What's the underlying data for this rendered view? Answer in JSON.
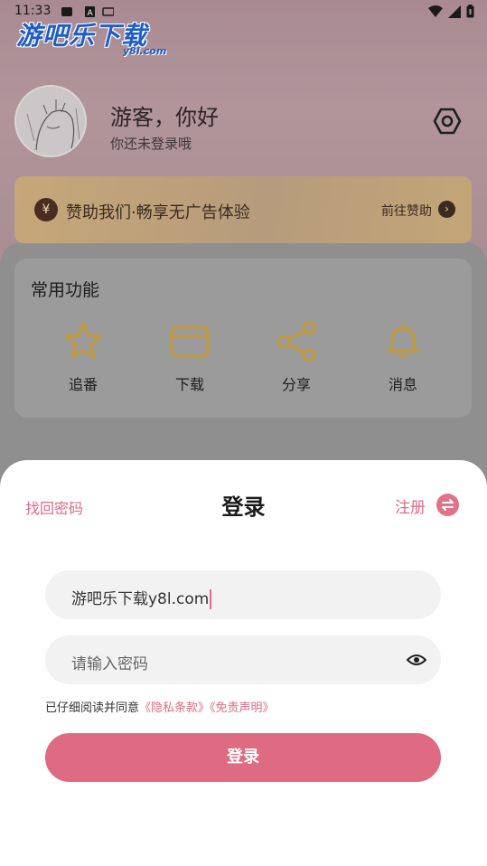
{
  "status_bar": {
    "time": "11:33"
  },
  "watermark": {
    "text": "游吧乐下载",
    "sub": "y8l.com"
  },
  "profile": {
    "greeting": "游客，你好",
    "subtitle": "你还未登录哦"
  },
  "sponsor": {
    "icon_char": "¥",
    "text": "赞助我们·畅享无广告体验",
    "link": "前往赞助",
    "arrow": "›"
  },
  "functions": {
    "title": "常用功能",
    "items": [
      {
        "label": "追番",
        "icon": "star-icon"
      },
      {
        "label": "下载",
        "icon": "folder-icon"
      },
      {
        "label": "分享",
        "icon": "share-icon"
      },
      {
        "label": "消息",
        "icon": "bell-icon"
      }
    ]
  },
  "login": {
    "forgot": "找回密码",
    "title": "登录",
    "register": "注册",
    "username_value": "游吧乐下载y8l.com",
    "password_placeholder": "请输入密码",
    "agree_prefix": "已仔细阅读并同意",
    "privacy_link": "《隐私条款》",
    "disclaimer_link": "《免责声明》",
    "submit": "登录"
  },
  "colors": {
    "accent": "#df6b82",
    "gold": "#c9a24a"
  }
}
